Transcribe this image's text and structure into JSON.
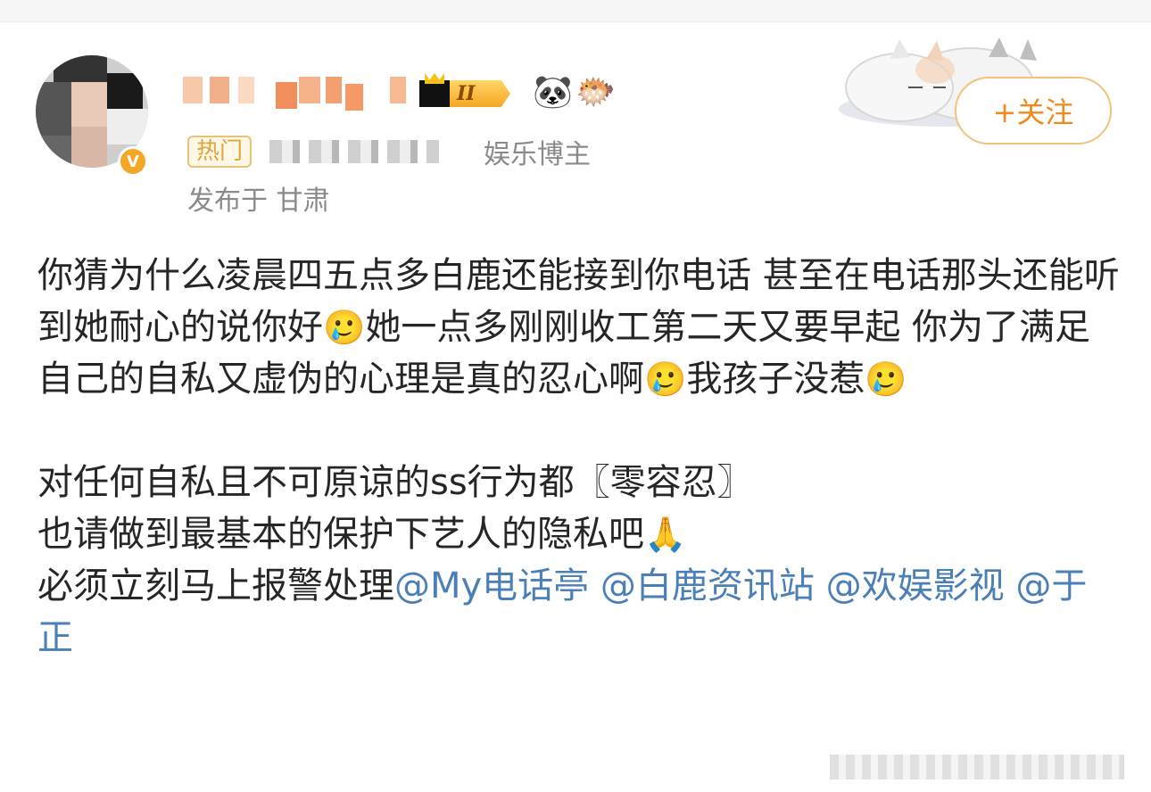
{
  "header": {
    "level_badge": "II",
    "hot_tag": "热门",
    "role": "娱乐博主",
    "location": "发布于 甘肃",
    "follow_label": "+关注"
  },
  "icons": {
    "verified": "verified-v-badge",
    "panda": "🐼",
    "fish": "🐡"
  },
  "post": {
    "p1_text": "你猜为什么凌晨四五点多白鹿还能接到你电话 甚至在电话那头还能听到她耐心的说你好",
    "p1_emoji1": "🥲",
    "p1_text2": "她一点多刚刚收工第二天又要早起 你为了满足自己的自私又虚伪的心理是真的忍心啊",
    "p1_emoji2": "🥲",
    "p1_text3": "我孩子没惹",
    "p1_emoji3": "🥲",
    "p2_line1": "对任何自私且不可原谅的ss行为都〖零容忍〗",
    "p2_line2": "也请做到最基本的保护下艺人的隐私吧",
    "p2_emoji": "🙏",
    "p2_line3": "必须立刻马上报警处理",
    "mention1": "@My电话亭",
    "mention2": "@白鹿资讯站",
    "mention3": "@欢娱影视",
    "mention4": "@于正"
  },
  "colors": {
    "accent": "#f08a1c",
    "mention": "#4a7fb8",
    "meta_text": "#8a8a8a"
  }
}
